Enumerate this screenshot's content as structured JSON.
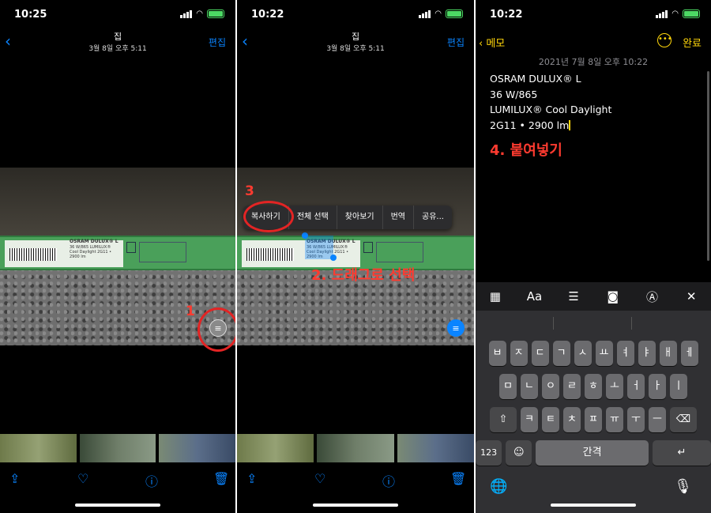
{
  "panel1": {
    "status": {
      "time": "10:25"
    },
    "nav": {
      "title": "집",
      "subtitle": "3월 8일 오후 5:11",
      "edit": "편집"
    },
    "annotation": {
      "number": "1"
    }
  },
  "panel2": {
    "status": {
      "time": "10:22"
    },
    "nav": {
      "title": "집",
      "subtitle": "3월 8일 오후 5:11",
      "edit": "편집"
    },
    "annotation": {
      "number": "3",
      "drag_label": "2. 드래그로 선택"
    },
    "menu": [
      "복사하기",
      "전체 선택",
      "찾아보기",
      "번역",
      "공유..."
    ]
  },
  "panel3": {
    "status": {
      "time": "10:22"
    },
    "nav": {
      "back": "메모",
      "done": "완료"
    },
    "date": "2021년 7월 8일 오후 10:22",
    "lines": [
      "OSRAM DULUX® L",
      "36 W/865",
      "LUMILUX® Cool Daylight",
      "2G11 • 2900 lm"
    ],
    "paste_label": "4. 붙여넣기",
    "keyboard": {
      "row1": [
        "ㅂ",
        "ㅈ",
        "ㄷ",
        "ㄱ",
        "ㅅ",
        "ㅛ",
        "ㅕ",
        "ㅑ",
        "ㅐ",
        "ㅔ"
      ],
      "row2": [
        "ㅁ",
        "ㄴ",
        "ㅇ",
        "ㄹ",
        "ㅎ",
        "ㅗ",
        "ㅓ",
        "ㅏ",
        "ㅣ"
      ],
      "row3": [
        "ㅋ",
        "ㅌ",
        "ㅊ",
        "ㅍ",
        "ㅠ",
        "ㅜ",
        "ㅡ"
      ],
      "numbers": "123",
      "space": "간격"
    }
  },
  "product_label": {
    "brand": "OSRAM DULUX® L",
    "spec": "36 W/865 LUMILUX® Cool Daylight 2G11 • 2900 lm"
  },
  "colors": {
    "accent_blue": "#0a84ff",
    "notes_yellow": "#ffd60a",
    "annotation_red": "#ff3b30"
  },
  "icons": [
    "share-icon",
    "heart-icon",
    "info-icon",
    "trash-icon",
    "live-text-icon",
    "table-icon",
    "checklist-icon",
    "camera-icon",
    "markup-icon",
    "close-icon",
    "globe-icon",
    "mic-icon"
  ]
}
